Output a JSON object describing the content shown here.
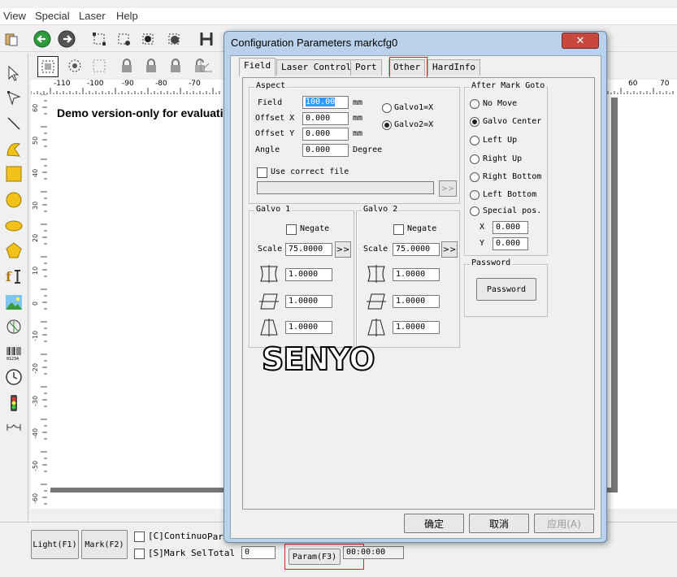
{
  "menubar": {
    "items": [
      "View",
      "Special",
      "Laser",
      "Help"
    ]
  },
  "toolbar": {
    "icons": [
      "paste-icon",
      "back-icon",
      "forward-icon",
      "select-node-icon",
      "node-icon",
      "node-edit-icon",
      "node-dot-icon",
      "h-icon"
    ]
  },
  "toolbar2": {
    "icons": [
      "group-icon",
      "rotate-icon",
      "ungroup-icon",
      "lock-icon",
      "lock-icon",
      "lock-icon",
      "unlock-icon",
      "align-icon"
    ]
  },
  "lefttools": [
    "pointer-icon",
    "node-pointer-icon",
    "line-icon",
    "curve-icon",
    "rectangle-icon",
    "circle-icon",
    "ellipse-icon",
    "polygon-icon",
    "text-icon",
    "image-icon",
    "vector-file-icon",
    "barcode-icon",
    "timer-icon",
    "io-icon",
    "extend-axis-icon"
  ],
  "ruler": {
    "h_labels": [
      "-110",
      "-100",
      "-90",
      "-80",
      "-70",
      "60",
      "70"
    ],
    "v_labels": [
      "60",
      "50",
      "40",
      "30",
      "20",
      "10",
      "0",
      "-10",
      "-20",
      "-30",
      "-40",
      "-50",
      "-60"
    ]
  },
  "canvas": {
    "demo_text": "Demo version-only for evaluatio"
  },
  "bottom": {
    "light_btn": "Light(F1)",
    "mark_btn": "Mark(F2)",
    "continuo_label": "[C]Continuo",
    "par_label": "Par",
    "marksel_label": "[S]Mark Sel",
    "total_label": "Total",
    "total_value": "0",
    "param_btn": "Param(F3)",
    "time_value": "00:00:00"
  },
  "dialog": {
    "title": "Configuration Parameters markcfg0",
    "close_glyph": "✕",
    "tabs": [
      "Field",
      "Laser Control",
      "Port",
      "Other",
      "HardInfo"
    ],
    "active_tab": "Field",
    "aspect": {
      "title": "Aspect",
      "field_label": "Field",
      "field_value": "100.00",
      "field_unit": "mm",
      "offx_label": "Offset X",
      "offx_value": "0.000",
      "offx_unit": "mm",
      "offy_label": "Offset Y",
      "offy_value": "0.000",
      "offy_unit": "mm",
      "angle_label": "Angle",
      "angle_value": "0.000",
      "angle_unit": "Degree",
      "galvo1x": "Galvo1=X",
      "galvo2x": "Galvo2=X",
      "galvo2x_selected": true,
      "correct_label": "Use correct file",
      "more_glyph": ">>"
    },
    "galvo1": {
      "title": "Galvo 1",
      "negate": "Negate",
      "scale_label": "Scale",
      "scale_value": "75.0000",
      "barrel": "1.0000",
      "parallelogram": "1.0000",
      "trapezoid": "1.0000"
    },
    "galvo2": {
      "title": "Galvo 2",
      "negate": "Negate",
      "scale_label": "Scale",
      "scale_value": "75.0000",
      "barrel": "1.0000",
      "parallelogram": "1.0000",
      "trapezoid": "1.0000"
    },
    "aftermark": {
      "title": "After Mark Goto",
      "options": [
        "No Move",
        "Galvo Center",
        "Left Up",
        "Right Up",
        "Right Bottom",
        "Left Bottom",
        "Special pos."
      ],
      "selected": "Galvo Center",
      "x_label": "X",
      "x_value": "0.000",
      "y_label": "Y",
      "y_value": "0.000"
    },
    "password": {
      "title": "Password",
      "button": "Password"
    },
    "buttons": {
      "ok": "确定",
      "cancel": "取消",
      "apply": "应用(A)"
    }
  },
  "watermark": "SENYO",
  "colors": {
    "dialog_frame": "#b9d1ea",
    "close_red": "#c9483d",
    "highlight_red": "#d22222"
  }
}
